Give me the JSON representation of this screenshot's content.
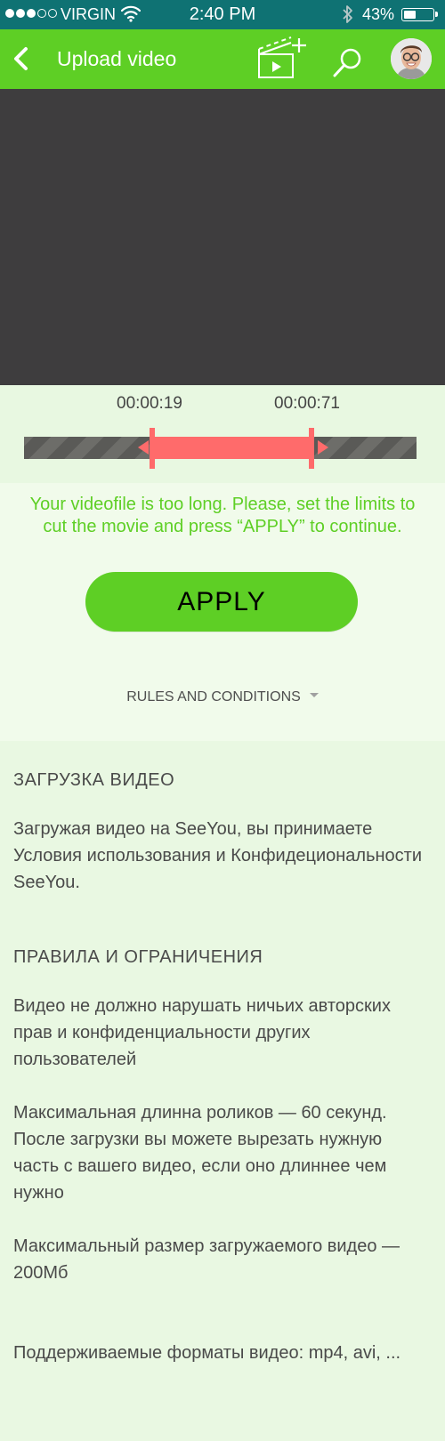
{
  "status": {
    "carrier": "VIRGIN",
    "time": "2:40 PM",
    "battery_pct": "43%",
    "battery_level": 0.43,
    "signal_bars_filled": 3,
    "signal_bars_total": 5,
    "bar_color": "#0f7273"
  },
  "header": {
    "title": "Upload video",
    "back_icon": "chevron-left-icon",
    "add_icon": "clapperboard-add-icon",
    "search_icon": "search-icon",
    "bg_color": "#5ecf25"
  },
  "trim": {
    "start_time": "00:00:19",
    "end_time": "00:00:71",
    "selection_color": "#ff6b6b"
  },
  "notice": "Your videofile is too long. Please, set the limits to cut the movie and press “APPLY” to continue.",
  "apply_label": "APPLY",
  "rules_toggle": "RULES AND CONDITIONS",
  "sections": [
    {
      "heading": "ЗАГРУЗКА ВИДЕО",
      "paragraphs": [
        "Загружая видео на SeeYou, вы принимаете Условия использования и Конфидециональности SeeYou."
      ]
    },
    {
      "heading": "ПРАВИЛА И ОГРАНИЧЕНИЯ",
      "paragraphs": [
        "Видео не должно нарушать ничьих авторских прав и конфиденциальности других пользователей",
        "Максимальная длинна роликов — 60 секунд. После загрузки вы можете вырезать нужную часть с вашего видео, если оно длиннее чем нужно",
        "Максимальный размер загружаемого видео — 200Мб",
        "Поддерживаемые форматы видео: mp4, avi, ..."
      ]
    }
  ]
}
